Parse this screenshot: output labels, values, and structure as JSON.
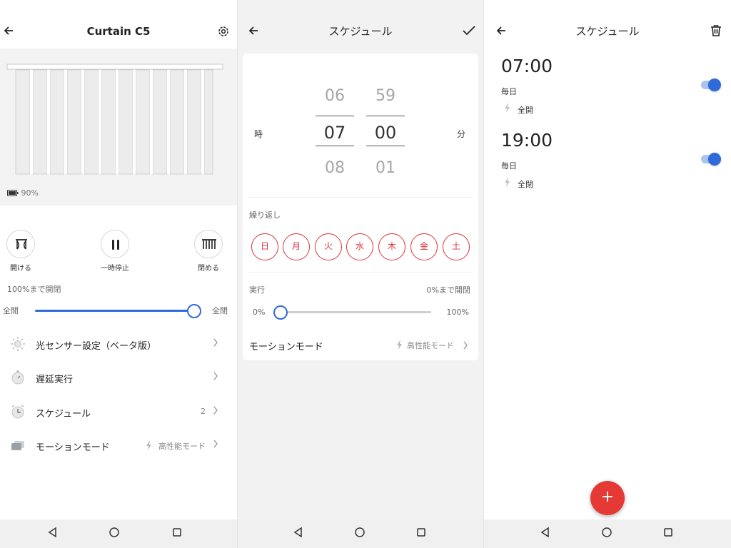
{
  "panel1": {
    "title": "Curtain C5",
    "battery": "90%",
    "controls": [
      {
        "label": "開ける",
        "icon": "curtain-open-icon"
      },
      {
        "label": "一時停止",
        "icon": "pause-icon"
      },
      {
        "label": "閉める",
        "icon": "curtain-close-icon"
      }
    ],
    "open_to_label": "100%まで開閉",
    "slider": {
      "left_label": "全開",
      "right_label": "全閉",
      "value_percent": 100
    },
    "menu": [
      {
        "label": "光センサー設定（ベータ版）",
        "value": "",
        "icon": "sun-icon"
      },
      {
        "label": "遅延実行",
        "value": "",
        "icon": "timer-icon"
      },
      {
        "label": "スケジュール",
        "value": "2",
        "icon": "clock-icon"
      },
      {
        "label": "モーションモード",
        "value": "高性能モード",
        "icon": "motion-mode-icon"
      }
    ]
  },
  "panel2": {
    "title": "スケジュール",
    "picker": {
      "hour_label": "時",
      "minute_label": "分",
      "hours": [
        "06",
        "07",
        "08"
      ],
      "minutes": [
        "59",
        "00",
        "01"
      ]
    },
    "repeat_label": "繰り返し",
    "days": [
      "日",
      "月",
      "火",
      "水",
      "木",
      "金",
      "土"
    ],
    "action_label": "実行",
    "action_value": "0%まで開閉",
    "slider": {
      "left_label": "0%",
      "right_label": "100%",
      "value_percent": 0
    },
    "motion_label": "モーションモード",
    "motion_value": "高性能モード"
  },
  "panel3": {
    "title": "スケジュール",
    "schedules": [
      {
        "time": "07:00",
        "repeat": "毎日",
        "action": "全開",
        "enabled": true
      },
      {
        "time": "19:00",
        "repeat": "毎日",
        "action": "全閉",
        "enabled": true
      }
    ],
    "fab_label": "+"
  },
  "colors": {
    "accent": "#2f6bd8",
    "danger": "#e53935",
    "day_border": "#d9363e"
  }
}
